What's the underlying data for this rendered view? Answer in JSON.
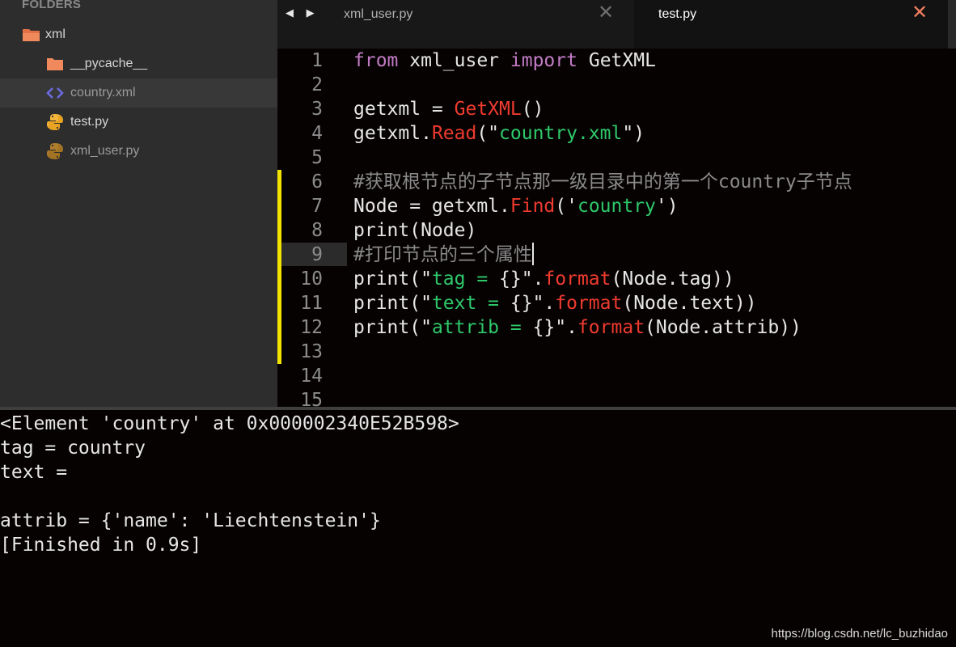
{
  "sidebar": {
    "header": "FOLDERS",
    "items": [
      {
        "label": "xml",
        "icon": "folder-open-icon"
      },
      {
        "label": "__pycache__",
        "icon": "folder-icon"
      },
      {
        "label": "country.xml",
        "icon": "xml-file-icon"
      },
      {
        "label": "test.py",
        "icon": "python-file-icon"
      },
      {
        "label": "xml_user.py",
        "icon": "python-file-icon"
      }
    ]
  },
  "tabs": {
    "nav": "◀ ▶",
    "items": [
      {
        "label": "xml_user.py",
        "close": "✕",
        "active": false
      },
      {
        "label": "test.py",
        "close": "✕",
        "active": true
      }
    ]
  },
  "editor": {
    "lines": [
      {
        "num": "1",
        "tokens": [
          [
            "kw",
            "from"
          ],
          [
            "",
            "xml_user"
          ],
          [
            "kw",
            "import"
          ],
          [
            "",
            "GetXML"
          ]
        ]
      },
      {
        "num": "2",
        "tokens": []
      },
      {
        "num": "3",
        "tokens": [
          [
            "",
            "getxml = "
          ],
          [
            "fn",
            "GetXML"
          ],
          [
            "",
            "()"
          ]
        ]
      },
      {
        "num": "4",
        "tokens": [
          [
            "",
            "getxml."
          ],
          [
            "fn",
            "Read"
          ],
          [
            "",
            "(\""
          ],
          [
            "str",
            "country.xml"
          ],
          [
            "",
            "\")"
          ]
        ]
      },
      {
        "num": "5",
        "tokens": []
      },
      {
        "num": "6",
        "tokens": [
          [
            "cmt",
            "#获取根节点的子节点那一级目录中的第一个country子节点"
          ]
        ]
      },
      {
        "num": "7",
        "tokens": [
          [
            "",
            "Node = getxml."
          ],
          [
            "fn",
            "Find"
          ],
          [
            "",
            "('"
          ],
          [
            "str",
            "country"
          ],
          [
            "",
            "')"
          ]
        ]
      },
      {
        "num": "8",
        "tokens": [
          [
            "",
            "print(Node)"
          ]
        ]
      },
      {
        "num": "9",
        "tokens": [
          [
            "cmt",
            "#打印节点的三个属性"
          ]
        ]
      },
      {
        "num": "10",
        "tokens": [
          [
            "",
            "print(\""
          ],
          [
            "str",
            "tag = "
          ],
          [
            "",
            "{}\"."
          ],
          [
            "fn",
            "format"
          ],
          [
            "",
            "(Node.tag))"
          ]
        ]
      },
      {
        "num": "11",
        "tokens": [
          [
            "",
            "print(\""
          ],
          [
            "str",
            "text = "
          ],
          [
            "",
            "{}\"."
          ],
          [
            "fn",
            "format"
          ],
          [
            "",
            "(Node.text))"
          ]
        ]
      },
      {
        "num": "12",
        "tokens": [
          [
            "",
            "print(\""
          ],
          [
            "str",
            "attrib = "
          ],
          [
            "",
            "{}\"."
          ],
          [
            "fn",
            "format"
          ],
          [
            "",
            "(Node.attrib))"
          ]
        ]
      },
      {
        "num": "13",
        "tokens": []
      },
      {
        "num": "14",
        "tokens": []
      },
      {
        "num": "15",
        "tokens": []
      }
    ],
    "cursor_line": "9",
    "modified_lines": [
      "6",
      "7",
      "8",
      "9",
      "10",
      "11",
      "12",
      "13"
    ]
  },
  "console": {
    "lines": [
      "<Element 'country' at 0x000002340E52B598>",
      "tag = country",
      "text =",
      "",
      "attrib = {'name': 'Liechtenstein'}",
      "[Finished in 0.9s]"
    ]
  },
  "watermark": "https://blog.csdn.net/lc_buzhidao",
  "colors": {
    "keyword": "#c27cc5",
    "function": "#ef3b2f",
    "string": "#2ec96a",
    "comment": "#8a8a8a",
    "modified_marker": "#f2e400",
    "tab_close_active": "#f07d5e"
  }
}
